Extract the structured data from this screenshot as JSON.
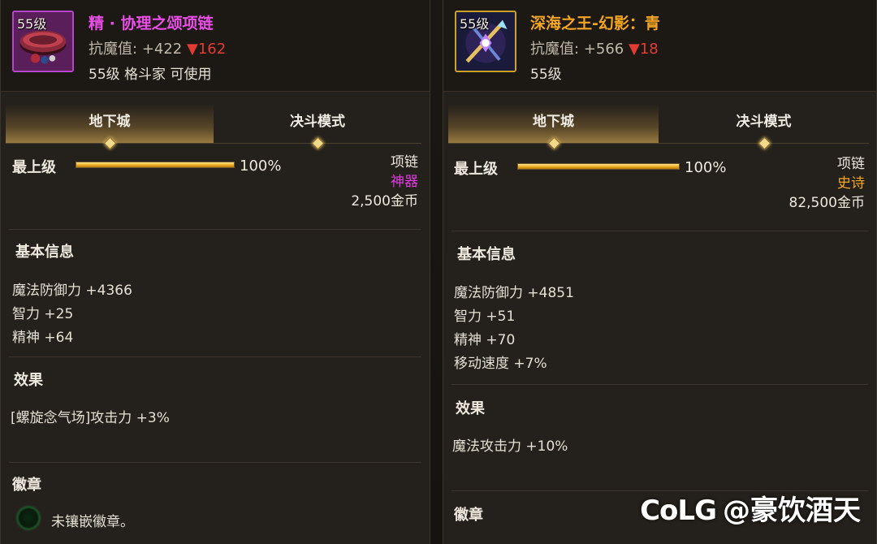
{
  "left_item": {
    "icon_level": "55级",
    "icon_name": "necklace-icon",
    "name": "精 · 协理之颂项链",
    "name_color": "#ec4fe9",
    "rarity_border": "#b446c8",
    "resist_label": "抗魔值:",
    "resist_value": "+422",
    "resist_drop": "▼162",
    "requirement": "55级 格斗家 可使用",
    "tabs": [
      "地下城",
      "决斗模式"
    ],
    "grade_label": "最上级",
    "grade_percent": "100%",
    "grade_fill": 1.0,
    "item_type": "项链",
    "rarity": "神器",
    "rarity_color": "#e23be0",
    "price": "2,500金币",
    "basic_title": "基本信息",
    "stats": [
      "魔法防御力 +4366",
      "智力 +25",
      "精神 +64"
    ],
    "effect_title": "效果",
    "effects": [
      "[螺旋念气场]攻击力 +3%"
    ],
    "emblem_title": "徽章",
    "emblem_text": "未镶嵌徽章。"
  },
  "right_item": {
    "icon_level": "55级",
    "icon_name": "staff-weapon-icon",
    "name": "深海之王-幻影：青",
    "name_color": "#f5a623",
    "rarity_border": "#c9a227",
    "resist_label": "抗魔值:",
    "resist_value": "+566",
    "resist_drop": "▼18",
    "requirement": "55级",
    "tabs": [
      "地下城",
      "决斗模式"
    ],
    "grade_label": "最上级",
    "grade_percent": "100%",
    "grade_fill": 1.0,
    "item_type": "项链",
    "rarity": "史诗",
    "rarity_color": "#f5a623",
    "price": "82,500金币",
    "basic_title": "基本信息",
    "stats": [
      "魔法防御力 +4851",
      "智力 +51",
      "精神 +70",
      "移动速度 +7%"
    ],
    "effect_title": "效果",
    "effects": [
      "魔法攻击力 +10%"
    ],
    "emblem_title": "徽章"
  },
  "watermark": {
    "logo": "CoLG",
    "text": "@豪饮酒天"
  }
}
